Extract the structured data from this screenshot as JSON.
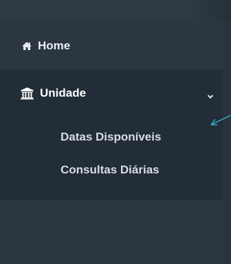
{
  "sidebar": {
    "home": {
      "label": "Home",
      "icon": "home-icon"
    },
    "unidade": {
      "label": "Unidade",
      "icon": "bank-icon",
      "expanded": true,
      "chevron_icon": "chevron-down-icon",
      "items": [
        {
          "label": "Datas Disponíveis"
        },
        {
          "label": "Consultas Diárias"
        }
      ]
    }
  },
  "colors": {
    "sidebar_bg": "#2b3641",
    "submenu_bg": "#232d37",
    "text": "#e8edf1",
    "annotation_arrow": "#3ab0d8"
  }
}
